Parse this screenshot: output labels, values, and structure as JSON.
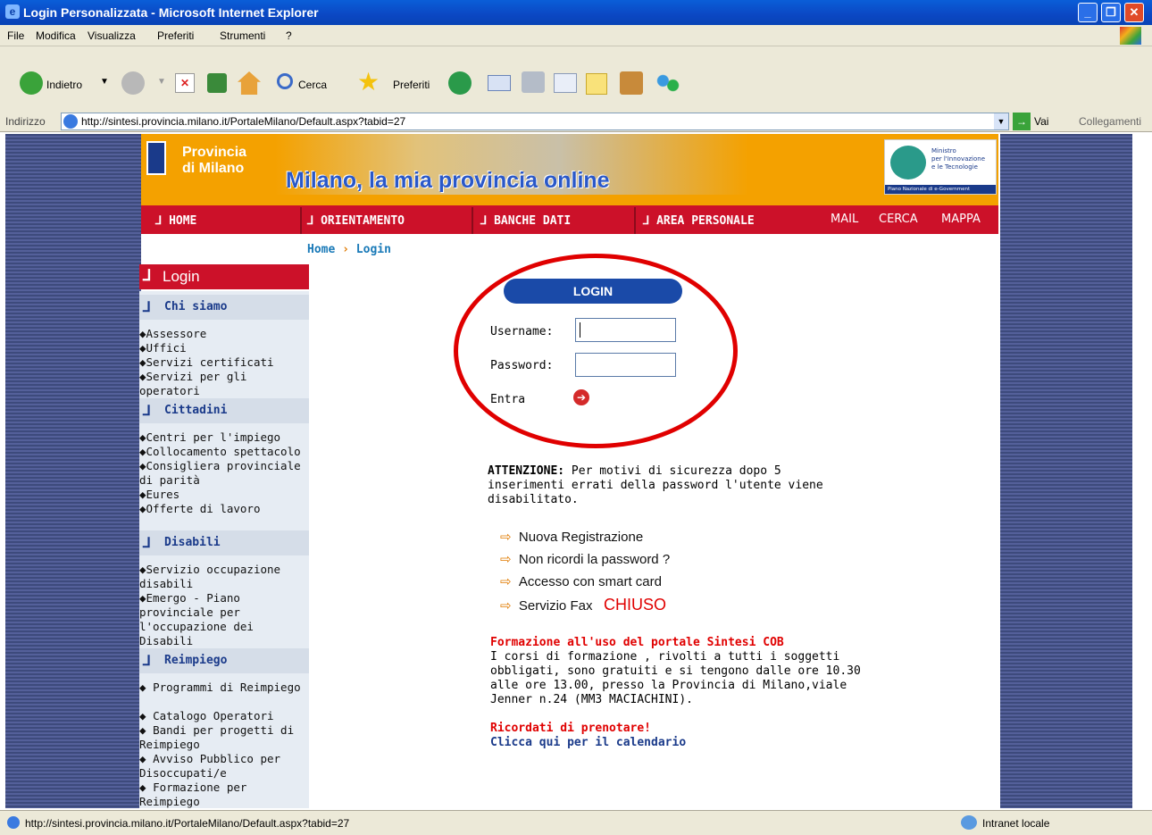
{
  "window": {
    "title": "Login Personalizzata - Microsoft Internet Explorer"
  },
  "menu": {
    "file": "File",
    "modifica": "Modifica",
    "visualizza": "Visualizza",
    "preferiti": "Preferiti",
    "strumenti": "Strumenti",
    "help": "?"
  },
  "toolbar": {
    "back": "Indietro",
    "search": "Cerca",
    "favorites": "Preferiti"
  },
  "address": {
    "label": "Indirizzo",
    "url": "http://sintesi.provincia.milano.it/PortaleMilano/Default.aspx?tabid=27",
    "go": "Vai",
    "links": "Collegamenti"
  },
  "banner": {
    "logo_line1": "Provincia",
    "logo_line2": "di Milano",
    "headline": "Milano, la mia provincia online",
    "ministry_1": "Ministro",
    "ministry_2": "per l'Innovazione",
    "ministry_3": "e le Tecnologie",
    "ministry_4": "Piano Nazionale di e-Government"
  },
  "nav": {
    "home": "HOME",
    "orientamento": "ORIENTAMENTO",
    "banche_dati": "BANCHE DATI",
    "area_personale": "AREA PERSONALE",
    "mail": "MAIL",
    "cerca": "CERCA",
    "mappa": "MAPPA"
  },
  "breadcrumb": {
    "home": "Home",
    "sep": "›",
    "current": "Login"
  },
  "sidebar": {
    "title": "Login",
    "chi_siamo": {
      "label": "Chi siamo",
      "items": [
        "Assessore",
        "Uffici",
        "Servizi certificati",
        "Servizi per gli operatori"
      ]
    },
    "cittadini": {
      "label": "Cittadini",
      "items": [
        "Centri per l'impiego",
        "Collocamento spettacolo",
        "Consigliera provinciale di parità",
        "Eures",
        "Offerte di lavoro"
      ]
    },
    "disabili": {
      "label": "Disabili",
      "items": [
        "Servizio occupazione disabili",
        "Emergo - Piano provinciale per l'occupazione dei Disabili"
      ]
    },
    "reimpiego": {
      "label": "Reimpiego",
      "items": [
        "Programmi di Reimpiego",
        "Catalogo Operatori",
        "Bandi per progetti di Reimpiego",
        "Avviso Pubblico per Disoccupati/e",
        "Formazione per Reimpiego"
      ]
    }
  },
  "login": {
    "header": "LOGIN",
    "username_label": "Username:",
    "password_label": "Password:",
    "username_value": "",
    "password_value": "",
    "submit_label": "Entra"
  },
  "notice": {
    "bold": "ATTENZIONE:",
    "line1": " Per motivi di sicurezza dopo 5",
    "line2": "inserimenti errati della password l'utente viene",
    "line3": "disabilitato."
  },
  "links": {
    "registrazione": "Nuova Registrazione",
    "password": "Non ricordi la password ?",
    "smart_card": "Accesso con smart card",
    "fax": "Servizio Fax",
    "fax_status": "CHIUSO"
  },
  "formazione": {
    "title": "Formazione all'uso del portale Sintesi COB",
    "line1": "I corsi di formazione , rivolti a tutti i soggetti",
    "line2": "obbligati, sono gratuiti e si tengono dalle ore 10.30",
    "line3": "alle ore 13.00, presso la Provincia di Milano,viale",
    "line4": "Jenner n.24 (MM3 MACIACHINI).",
    "reminder": "Ricordati di prenotare!",
    "calendar_link": "Clicca qui per il calendario"
  },
  "status": {
    "url": "http://sintesi.provincia.milano.it/PortaleMilano/Default.aspx?tabid=27",
    "zone": "Intranet locale"
  },
  "colors": {
    "accent_red": "#cc1129",
    "banner_orange": "#f4a100",
    "link_blue": "#1a3a8a",
    "annotation_red": "#e00000"
  }
}
